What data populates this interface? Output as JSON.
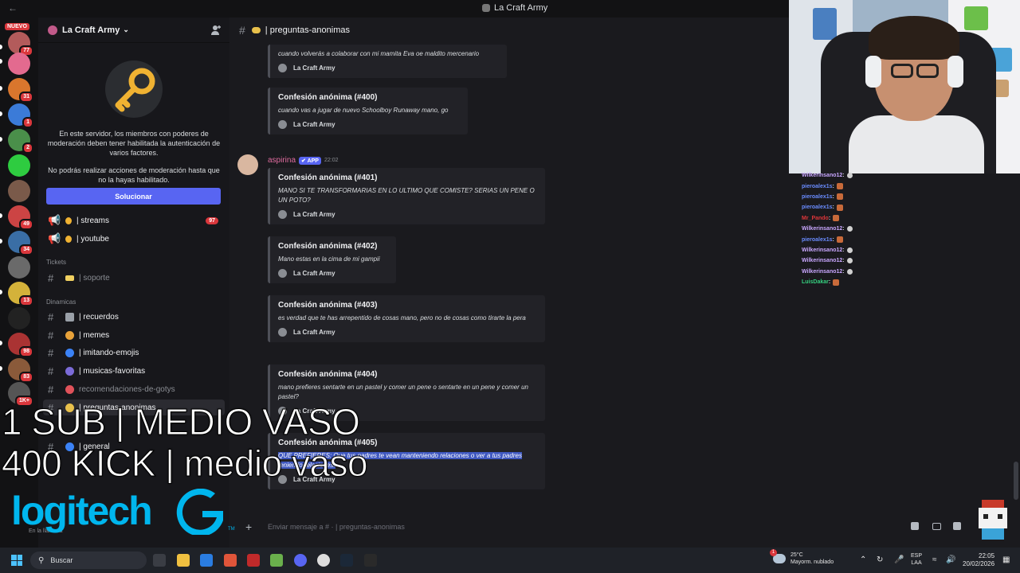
{
  "titlebar": {
    "title": "La Craft Army",
    "back": "←",
    "forward": "→"
  },
  "rail": {
    "nuevo": "NUEVO",
    "badges": [
      "77",
      "31",
      "1",
      "2",
      "49",
      "34",
      "13",
      "98",
      "83",
      "1K+"
    ]
  },
  "sidebar": {
    "server_name": "La Craft Army",
    "mfa_text_1": "En este servidor, los miembros con poderes de moderación deben tener habilitada la autenticación de varios factores.",
    "mfa_text_2": "No podrás realizar acciones de moderación hasta que no la hayas habilitado.",
    "fix_button": "Solucionar",
    "channels": {
      "streams": "| streams",
      "streams_badge": "97",
      "youtube": "| youtube",
      "cat_tickets": "Tickets",
      "soporte": "| soporte",
      "cat_dinamicas": "Dinamicas",
      "recuerdos": "| recuerdos",
      "memes": "| memes",
      "imitando": "| imitando-emojis",
      "musicas": "| musicas-favoritas",
      "recomendaciones": "recomendaciones-de-gotys",
      "preguntas": "| preguntas-anonimas",
      "general": "| general"
    },
    "user_status": "En la llamada"
  },
  "chat": {
    "channel_name": "| preguntas-anonimas",
    "embeds": [
      {
        "title": "",
        "body": "cuando volverás a colaborar con mi mamita Eva oe maldito mercenario",
        "footer": "La Craft Army"
      },
      {
        "title": "Confesión anónima (#400)",
        "body": "cuando vas a jugar de nuevo Schoolboy Runaway mano, go",
        "footer": "La Craft Army"
      },
      {
        "title": "Confesión anónima (#401)",
        "body": "MANO SI TE TRANSFORMARIAS EN LO ULTIMO QUE COMISTE? SERIAS UN PENE O UN POTO?",
        "footer": "La Craft Army"
      },
      {
        "title": "Confesión anónima (#402)",
        "body": "Mano estas en la cima de mi gampii",
        "footer": "La Craft Army"
      },
      {
        "title": "Confesión anónima (#403)",
        "body": "es verdad que te has arrepentido de cosas mano, pero no de cosas como tirarte la pera",
        "footer": "La Craft Army"
      },
      {
        "title": "Confesión anónima (#404)",
        "body": "mano prefieres sentarte en un pastel y comer un pene o sentarte en un pene y comer un pastel?",
        "footer": "La Craft Army"
      },
      {
        "title": "Confesión anónima (#405)",
        "body": "QUE PREFIERES: Que tus padres te vean manteniendo relaciones o ver a tus padres teniendo relaciones.",
        "footer": "La Craft Army"
      }
    ],
    "author": {
      "name": "aspirina",
      "tag": "✔ APP",
      "time": "22:02"
    },
    "composer_placeholder": "Enviar mensaje a # · | preguntas-anonimas"
  },
  "livechat": [
    {
      "user": "Wilkerinsano12",
      "color": "#c9a7ff",
      "emote": "ghost"
    },
    {
      "user": "pieroalex1s",
      "color": "#6a8cff",
      "emote": "face"
    },
    {
      "user": "pieroalex1s",
      "color": "#6a8cff",
      "emote": "face"
    },
    {
      "user": "pieroalex1s",
      "color": "#6a8cff",
      "emote": "face"
    },
    {
      "user": "Mr_Pando",
      "color": "#e0363a",
      "emote": "face"
    },
    {
      "user": "Wilkerinsano12",
      "color": "#c9a7ff",
      "emote": "ghost"
    },
    {
      "user": "pieroalex1s",
      "color": "#6a8cff",
      "emote": "face"
    },
    {
      "user": "Wilkerinsano12",
      "color": "#c9a7ff",
      "emote": "ghost"
    },
    {
      "user": "Wilkerinsano12",
      "color": "#c9a7ff",
      "emote": "ghost"
    },
    {
      "user": "Wilkerinsano12",
      "color": "#c9a7ff",
      "emote": "ghost"
    },
    {
      "user": "LuisDakar",
      "color": "#35d07f",
      "emote": "face"
    }
  ],
  "overlay": {
    "line1": "1 SUB | MEDIO VASO",
    "line2": "400 KICK | medio vaso",
    "brand": "logitech",
    "brand_tm": "TM"
  },
  "taskbar": {
    "search": "Buscar",
    "weather_temp": "25°C",
    "weather_desc": "Mayorm. nublado",
    "weather_badge": "1",
    "lang_1": "ESP",
    "lang_2": "LAA",
    "time": "22:05",
    "date": "20/02/2026"
  },
  "colors": {
    "accent": "#5865f2",
    "danger": "#da373c",
    "logitech": "#00b6ee"
  }
}
